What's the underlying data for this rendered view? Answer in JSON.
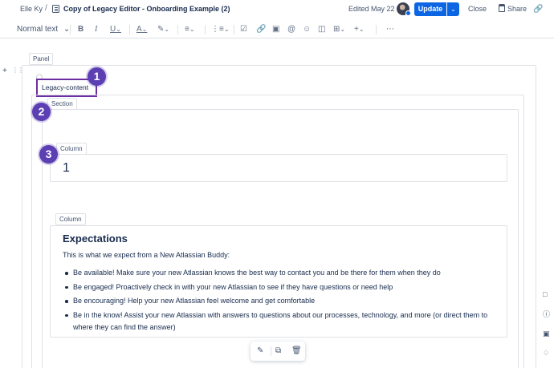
{
  "header": {
    "user": "Elle Ky",
    "separator": "/",
    "title": "Copy of Legacy Editor - Onboarding Example (2)",
    "edited": "Edited May 22",
    "update_label": "Update",
    "close_label": "Close",
    "share_label": "Share"
  },
  "toolbar": {
    "text_style": "Normal text",
    "icons": [
      "bold-icon",
      "italic-icon",
      "underline-icon",
      "text-color-icon",
      "highlight-icon",
      "align-icon",
      "list-icon",
      "task-icon",
      "link-icon",
      "image-icon",
      "mention-icon",
      "emoji-icon",
      "layout-icon",
      "table-icon",
      "insert-icon",
      "more-icon"
    ]
  },
  "editor": {
    "panel_tag": "Panel",
    "legacy_label": "Legacy-content",
    "section_tag": "Section",
    "column_tag_1": "Column",
    "column_1_text": "1",
    "column_tag_2": "Column",
    "heading": "Expectations",
    "intro": "This is what we expect from a New Atlassian Buddy:",
    "bullets": [
      "Be available! Make sure your new Atlassian knows the best way to contact you and be there for them when they do",
      "Be engaged! Proactively check in with your new Atlassian to see if they have questions or need help",
      "Be encouraging! Help your new Atlassian feel welcome and get comfortable",
      "Be in the know! Assist your new Atlassian with answers to questions about our processes, technology, and more (or direct them to where they can find the answer)"
    ]
  },
  "annotations": {
    "badge_1": "1",
    "badge_2": "2",
    "badge_3": "3",
    "badge_color": "#5b3fb3",
    "highlight_color": "#6b2fa3"
  },
  "colors": {
    "primary": "#0c66e4",
    "text": "#172b4d",
    "border": "#dfe1e6"
  }
}
